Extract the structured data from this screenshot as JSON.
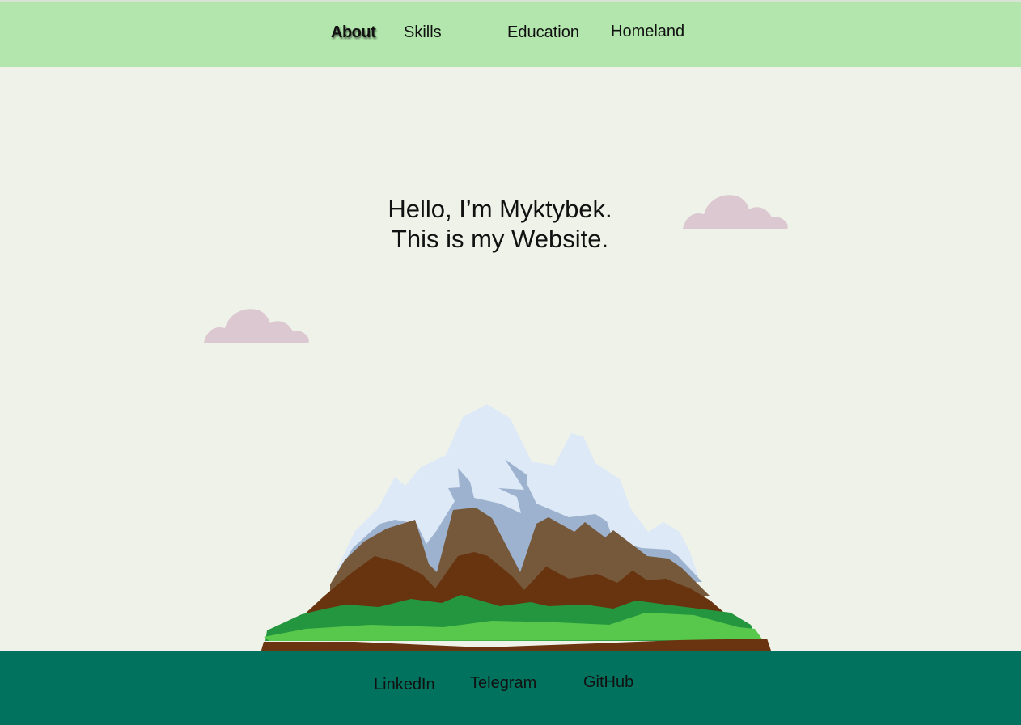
{
  "nav": {
    "items": [
      {
        "label": "About",
        "active": true
      },
      {
        "label": "Skills",
        "active": false
      },
      {
        "label": "Education",
        "active": false
      },
      {
        "label": "Homeland",
        "active": false
      }
    ]
  },
  "hero": {
    "line1": "Hello, I’m Myktybek.",
    "line2": "This is my Website."
  },
  "footer": {
    "links": [
      {
        "label": "LinkedIn"
      },
      {
        "label": "Telegram"
      },
      {
        "label": "GitHub"
      }
    ]
  },
  "colors": {
    "navbar_bg": "#b2e6ad",
    "page_bg": "#eff2e8",
    "footer_bg": "#00725e",
    "cloud": "#dcc8d1"
  },
  "illustrations": {
    "clouds": [
      "cloud-illustration",
      "cloud-illustration"
    ],
    "mountain": "mountain-illustration"
  }
}
